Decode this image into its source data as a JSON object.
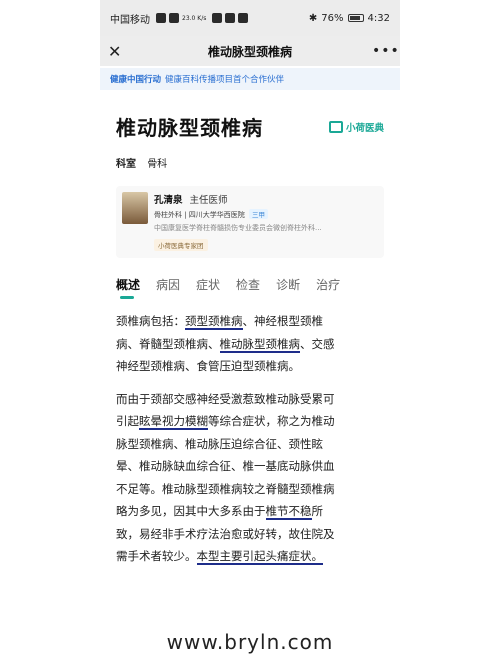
{
  "status": {
    "carrier": "中国移动",
    "network": "23.0 K/s",
    "battery": "76%",
    "time": "4:32"
  },
  "nav": {
    "close_icon": "close-icon",
    "title": "椎动脉型颈椎病",
    "more": "•••"
  },
  "banner": {
    "brand": "健康中国行动",
    "desc": "健康百科传播项目首个合作伙伴"
  },
  "article": {
    "title": "椎动脉型颈椎病",
    "logo": "小荷医典",
    "dept_label": "科室",
    "dept_value": "骨科"
  },
  "doctor": {
    "name": "孔清泉",
    "title": "主任医师",
    "hospital": "骨柱外科 | 四川大学华西医院",
    "tag": "三甲",
    "bio": "中国康复医学脊柱脊髓损伤专业委员会微创脊柱外科...",
    "badge": "小荷医典专家团"
  },
  "tabs": [
    "概述",
    "病因",
    "症状",
    "检查",
    "诊断",
    "治疗"
  ],
  "paragraph1": {
    "l1_pre": "颈椎病包括：",
    "l1_u": "颈型颈椎病",
    "l1_post": "、神经根型颈椎",
    "l2_pre": "病、脊髓型颈椎病、",
    "l2_u": "椎动脉型颈椎病",
    "l2_post": "、交感",
    "l3": "神经型颈椎病、食管压迫型颈椎病。"
  },
  "paragraph2": {
    "l1": "而由于颈部交感神经受激惹致椎动脉受累可",
    "l2_pre": "引起",
    "l2_u": "眩晕视力模糊",
    "l2_post": "等综合症状，称之为椎动",
    "l3": "脉型颈椎病、椎动脉压迫综合征、颈性眩",
    "l4": "晕、椎动脉缺血综合征、椎一基底动脉供血",
    "l5": "不足等。椎动脉型颈椎病较之脊髓型颈椎病",
    "l6_pre": "略为多见，因其中大多系由于",
    "l6_u": "椎节不稳",
    "l6_post": "所",
    "l7": "致，易经非手术疗法治愈或好转，故住院及",
    "l8_pre": "需手术者较少。",
    "l8_u": "本型主要引起头痛症状。"
  },
  "watermark": "www.bryln.com"
}
